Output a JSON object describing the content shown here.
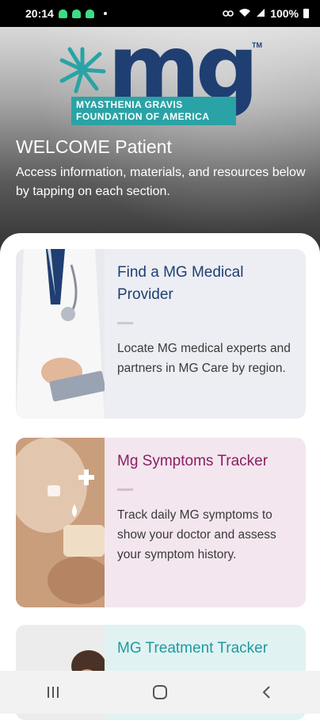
{
  "status_bar": {
    "time": "20:14",
    "battery": "100%"
  },
  "logo": {
    "mark": "mg",
    "tm": "TM",
    "line1": "MYASTHENIA GRAVIS",
    "line2": "FOUNDATION OF AMERICA"
  },
  "header": {
    "title": "WELCOME Patient",
    "subtitle": "Access information, materials, and resources below by tapping on each section."
  },
  "cards": [
    {
      "title": "Find a MG Medical Provider",
      "description": "Locate MG medical experts and partners in MG Care by region.",
      "image_icon": "doctor-tablet-photo"
    },
    {
      "title": "Mg Symptoms Tracker",
      "description": "Track daily MG symptoms to show your doctor and assess your symptom history.",
      "image_icon": "phone-health-photo"
    },
    {
      "title": "MG Treatment Tracker",
      "description": "",
      "image_icon": "person-photo"
    }
  ],
  "nav": {
    "recents_icon": "recents-icon",
    "home_icon": "home-icon",
    "back_icon": "back-icon"
  },
  "colors": {
    "brand_navy": "#1f3f72",
    "brand_teal": "#2aa3a6",
    "symptoms_magenta": "#8a1e63",
    "treatment_teal": "#1e9aa0"
  }
}
